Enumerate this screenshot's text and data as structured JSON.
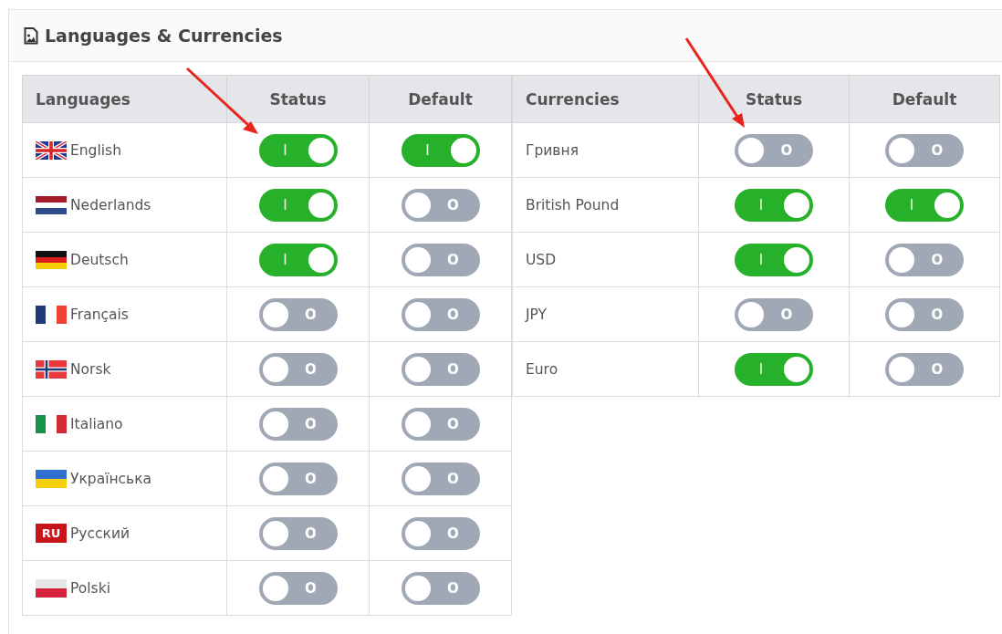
{
  "panel": {
    "title": "Languages & Currencies"
  },
  "languages": {
    "columns": [
      "Languages",
      "Status",
      "Default"
    ],
    "rows": [
      {
        "name": "English",
        "kind": "gb",
        "status": true,
        "status_label": "I",
        "default": true,
        "default_label": "I"
      },
      {
        "name": "Nederlands",
        "kind": "nl",
        "status": true,
        "status_label": "I",
        "default": false,
        "default_label": "O"
      },
      {
        "name": "Deutsch",
        "kind": "de",
        "status": true,
        "status_label": "I",
        "default": false,
        "default_label": "O"
      },
      {
        "name": "Français",
        "kind": "fr",
        "status": false,
        "status_label": "O",
        "default": false,
        "default_label": "O"
      },
      {
        "name": "Norsk",
        "kind": "no",
        "status": false,
        "status_label": "O",
        "default": false,
        "default_label": "O"
      },
      {
        "name": "Italiano",
        "kind": "it",
        "status": false,
        "status_label": "O",
        "default": false,
        "default_label": "O"
      },
      {
        "name": "Українська",
        "kind": "ua",
        "status": false,
        "status_label": "O",
        "default": false,
        "default_label": "O"
      },
      {
        "name": "Русский",
        "kind": "badge",
        "flag_text": "RU",
        "status": false,
        "status_label": "O",
        "default": false,
        "default_label": "O"
      },
      {
        "name": "Polski",
        "kind": "pl",
        "status": false,
        "status_label": "O",
        "default": false,
        "default_label": "O"
      }
    ]
  },
  "currencies": {
    "columns": [
      "Currencies",
      "Status",
      "Default"
    ],
    "rows": [
      {
        "name": "Гривня",
        "status": false,
        "status_label": "O",
        "default": false,
        "default_label": "O"
      },
      {
        "name": "British Pound",
        "status": true,
        "status_label": "I",
        "default": true,
        "default_label": "I"
      },
      {
        "name": "USD",
        "status": true,
        "status_label": "I",
        "default": false,
        "default_label": "O"
      },
      {
        "name": "JPY",
        "status": false,
        "status_label": "O",
        "default": false,
        "default_label": "O"
      },
      {
        "name": "Euro",
        "status": true,
        "status_label": "I",
        "default": false,
        "default_label": "O"
      }
    ]
  }
}
